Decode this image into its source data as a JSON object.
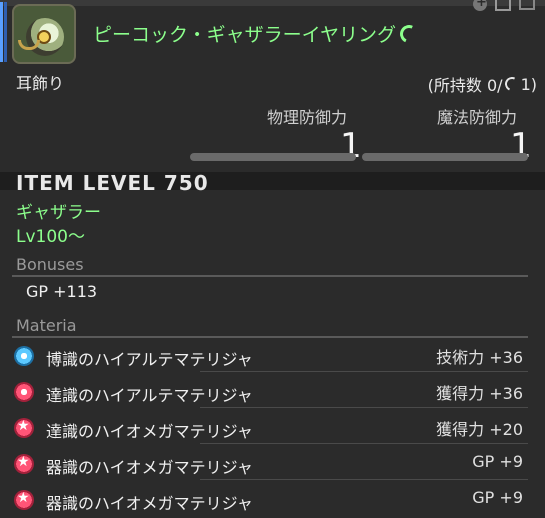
{
  "header": {
    "item_name": "ピーコック・ギャザラーイヤリング",
    "hq_icon": "hq-icon",
    "category": "耳飾り",
    "owned_prefix": "(所持数 0/",
    "owned_suffix": " 1)"
  },
  "stats": {
    "physical_label": "物理防御力",
    "physical_value": "1",
    "magic_label": "魔法防御力",
    "magic_value": "1"
  },
  "item_level": "ITEM LEVEL 750",
  "requirements": {
    "job": "ギャザラー",
    "level": "Lv100～"
  },
  "bonuses": {
    "title": "Bonuses",
    "items": [
      "GP +113"
    ]
  },
  "materia": {
    "title": "Materia",
    "items": [
      {
        "name": "博識のハイアルテマテリジャ",
        "bonus": "技術力 +36",
        "icon": "blue-materia-icon"
      },
      {
        "name": "達識のハイアルテマテリジャ",
        "bonus": "獲得力 +36",
        "icon": "red-materia-icon"
      },
      {
        "name": "達識のハイオメガマテリジャ",
        "bonus": "獲得力 +20",
        "icon": "star-materia-icon"
      },
      {
        "name": "器識のハイオメガマテリジャ",
        "bonus": "GP +9",
        "icon": "star-materia-icon"
      },
      {
        "name": "器識のハイオメガマテリジャ",
        "bonus": "GP +9",
        "icon": "star-materia-icon"
      }
    ]
  },
  "colors": {
    "name_green": "#8cff8c",
    "background": "#2b2b2b"
  }
}
